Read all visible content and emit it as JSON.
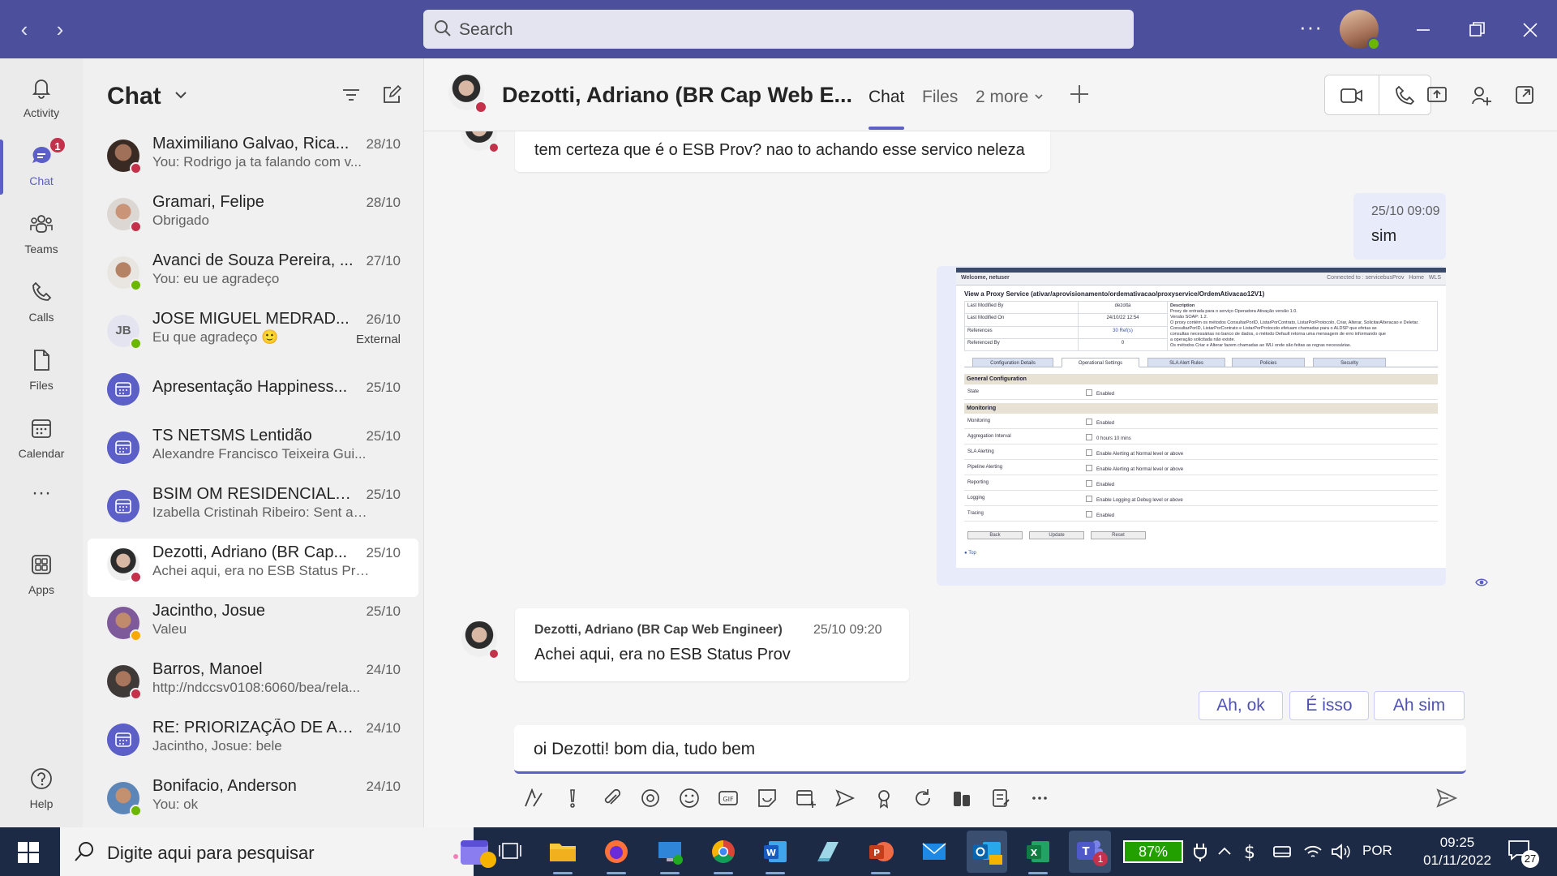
{
  "titlebar": {
    "search_placeholder": "Search",
    "more_label": "···"
  },
  "rail": {
    "items": [
      {
        "label": "Activity",
        "icon": "bell-icon"
      },
      {
        "label": "Chat",
        "icon": "chat-icon",
        "badge": "1"
      },
      {
        "label": "Teams",
        "icon": "teams-icon"
      },
      {
        "label": "Calls",
        "icon": "phone-icon"
      },
      {
        "label": "Files",
        "icon": "file-icon"
      },
      {
        "label": "Calendar",
        "icon": "calendar-icon"
      },
      {
        "label": "···",
        "icon": "more-icon"
      },
      {
        "label": "Apps",
        "icon": "apps-icon"
      },
      {
        "label": "Help",
        "icon": "help-icon"
      }
    ]
  },
  "chatlist": {
    "title": "Chat",
    "items": [
      {
        "name": "Maximiliano Galvao, Rica...",
        "preview": "You: Rodrigo ja ta falando com v...",
        "date": "28/10"
      },
      {
        "name": "Gramari, Felipe",
        "preview": "Obrigado",
        "date": "28/10"
      },
      {
        "name": "Avanci de Souza Pereira, ...",
        "preview": "You: eu ue agradeço",
        "date": "27/10"
      },
      {
        "name": "JOSE MIGUEL MEDRAD...",
        "preview": "Eu que agradeço 🙂",
        "date": "26/10",
        "tag": "External",
        "initials": "JB"
      },
      {
        "name": "Apresentação Happiness...",
        "preview": "",
        "date": "25/10"
      },
      {
        "name": "TS NETSMS Lentidão",
        "preview": "Alexandre Francisco Teixeira Gui...",
        "date": "25/10"
      },
      {
        "name": "BSIM OM RESIDENCIAL -...",
        "preview": "Izabella Cristinah Ribeiro: Sent an...",
        "date": "25/10"
      },
      {
        "name": "Dezotti, Adriano (BR Cap...",
        "preview": "Achei aqui, era no ESB Status Prov",
        "date": "25/10"
      },
      {
        "name": "Jacintho, Josue",
        "preview": "Valeu",
        "date": "25/10"
      },
      {
        "name": "Barros, Manoel",
        "preview": "http://ndccsv0108:6060/bea/rela...",
        "date": "24/10"
      },
      {
        "name": "RE: PRIORIZAÇÃO DE AL...",
        "preview": "Jacintho, Josue: bele",
        "date": "24/10"
      },
      {
        "name": "Bonifacio, Anderson",
        "preview": "You: ok",
        "date": "24/10"
      }
    ]
  },
  "header": {
    "name": "Dezotti, Adriano (BR Cap Web E...",
    "tabs": [
      "Chat",
      "Files",
      "2 more"
    ]
  },
  "messages": {
    "m1_text": "tem certeza que é o ESB Prov? nao to achando esse servico neleza",
    "m2_time": "25/10 09:09",
    "m2_text": "sim",
    "m3_author": "Dezotti, Adriano (BR Cap Web Engineer)",
    "m3_time": "25/10 09:20",
    "m3_text": "Achei aqui, era no ESB Status Prov"
  },
  "screenshot": {
    "welcome": "Welcome, netuser",
    "connected": "Connected to : servicebusProv",
    "home": "Home",
    "wls": "WLS",
    "heading": "View a Proxy Service (ativar/aprovisionamento/ordemativacao/proxyservice/OrdemAtivacao12V1)",
    "info_rows": [
      {
        "k": "Last Modified By",
        "v": "dezotta"
      },
      {
        "k": "Last Modified On",
        "v": "24/10/22 12:54"
      },
      {
        "k": "References",
        "v": "30 Ref(s)"
      },
      {
        "k": "Referenced By",
        "v": "0"
      }
    ],
    "desc_label": "Description",
    "desc_lines": [
      "Proxy de entrada para o serviço Operadora Ativação versão 1.0.",
      "Versão SOAP: 1.2.",
      "O proxy contém os métodos ConsultarPorID, ListarPorContrato, ListarPorProtocolo, Criar, Alterar, SolicitarAlteracao e Deletar.",
      "ConsultarPorID, ListarPorContrato e ListarPorProtocolo efetuam chamadas para o ALDSP que efetua as",
      "consultas necessárias no banco de dados, o método Default retorna uma mensagem de erro informando que",
      "a operação solicitada não existe.",
      "Os métodos Criar e Alterar fazem chamadas ao WLI onde são feitas as regras necessárias."
    ],
    "tabs": [
      "Configuration Details",
      "Operational Settings",
      "SLA Alert Rules",
      "Policies",
      "Security"
    ],
    "sec1": "General Configuration",
    "sec1_rows": [
      {
        "k": "State",
        "v": "Enabled"
      }
    ],
    "sec2": "Monitoring",
    "sec2_rows": [
      {
        "k": "Monitoring",
        "v": "Enabled"
      },
      {
        "k": "Aggregation Interval",
        "v": "0  hours  10  mins"
      },
      {
        "k": "SLA Alerting",
        "v": "Enable Alerting at  Normal  level or above"
      },
      {
        "k": "Pipeline Alerting",
        "v": "Enable Alerting at  Normal  level or above"
      },
      {
        "k": "Reporting",
        "v": "Enabled"
      },
      {
        "k": "Logging",
        "v": "Enable Logging at  Debug  level or above"
      },
      {
        "k": "Tracing",
        "v": "Enabled"
      }
    ],
    "buttons": [
      "Back",
      "Update",
      "Reset"
    ],
    "top_link": "Top"
  },
  "quick_replies": [
    "Ah, ok",
    "É isso",
    "Ah sim"
  ],
  "compose": {
    "text": "oi Dezotti! bom dia, tudo bem"
  },
  "taskbar": {
    "search_text": "Digite aqui para pesquisar",
    "battery": "87%",
    "lang": "POR",
    "time": "09:25",
    "date": "01/11/2022",
    "notif_count": "27",
    "teams_badge": "1"
  },
  "colors": {
    "brand": "#4b4f9c",
    "accent": "#5b5fc7",
    "busy": "#c4314b",
    "available": "#6bb700",
    "away": "#f8a800"
  }
}
